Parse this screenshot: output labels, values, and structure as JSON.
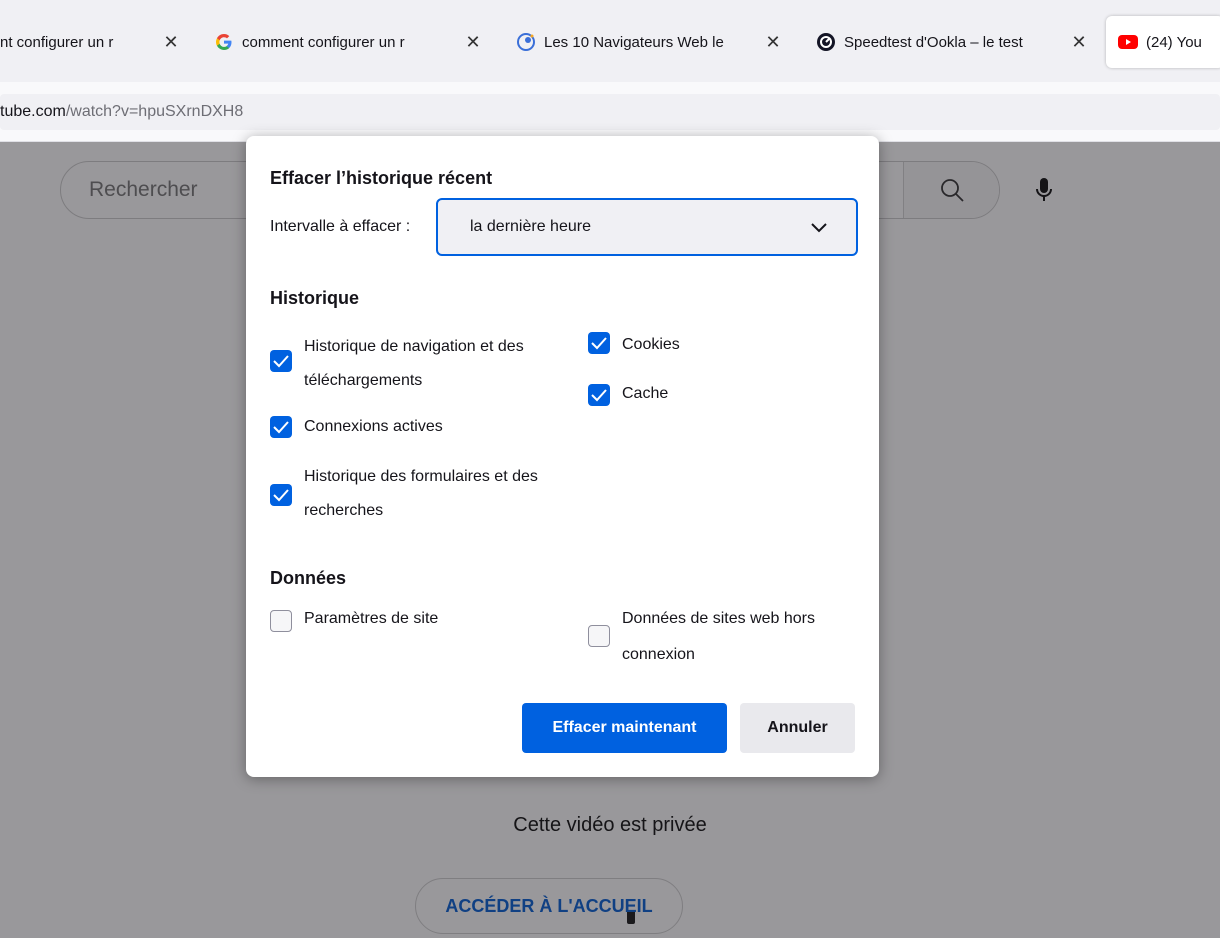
{
  "tabs": [
    {
      "title": "nt configurer un r",
      "icon": "none",
      "close": "✕"
    },
    {
      "title": "comment configurer un r",
      "icon": "google-icon",
      "close": "✕"
    },
    {
      "title": "Les 10 Navigateurs Web le",
      "icon": "browser-icon",
      "close": "✕"
    },
    {
      "title": "Speedtest d'Ookla – le test",
      "icon": "speedtest-icon",
      "close": "✕"
    },
    {
      "title": "(24) You",
      "icon": "youtube-icon",
      "active": true
    }
  ],
  "address": {
    "host": "tube.com",
    "path": "/watch?v=hpuSXrnDXH8"
  },
  "youtube": {
    "search_placeholder": "Rechercher",
    "private_message": "Cette vidéo est privée",
    "home_button": "ACCÉDER À L'ACCUEIL"
  },
  "dialog": {
    "title": "Effacer l’historique récent",
    "interval_label": "Intervalle à effacer :",
    "interval_value": "la dernière heure",
    "history_heading": "Historique",
    "history_items": [
      {
        "line1": "Historique de navigation et des",
        "line2": "téléchargements",
        "checked": true
      },
      {
        "line1": "Connexions actives",
        "checked": true
      },
      {
        "line1": "Historique des formulaires et des",
        "line2": "recherches",
        "checked": true
      },
      {
        "line1": "Cookies",
        "checked": true
      },
      {
        "line1": "Cache",
        "checked": true
      }
    ],
    "data_heading": "Données",
    "data_items": [
      {
        "line1": "Paramètres de site",
        "checked": false
      },
      {
        "line1": "Données de sites web hors",
        "line2": "connexion",
        "checked": false
      }
    ],
    "clear_button": "Effacer maintenant",
    "cancel_button": "Annuler"
  },
  "colors": {
    "accent": "#0061e0",
    "youtube_link": "#065fd4"
  }
}
